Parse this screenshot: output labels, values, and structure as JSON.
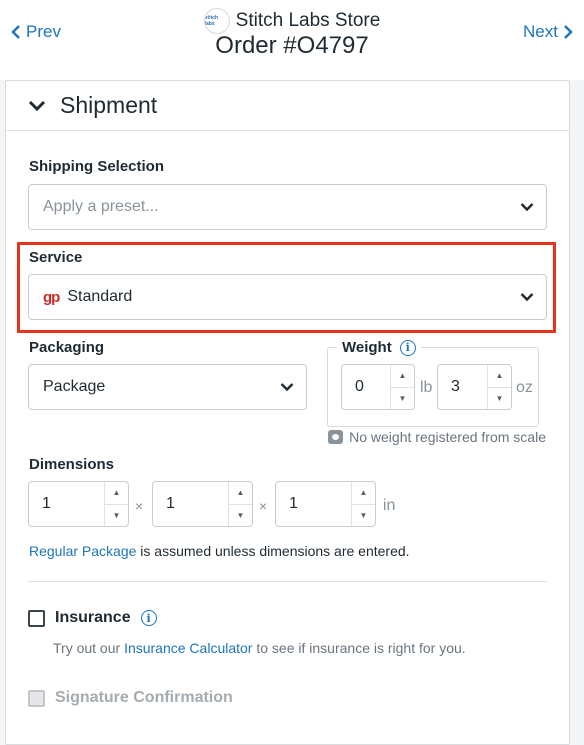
{
  "nav": {
    "prev_label": "Prev",
    "next_label": "Next"
  },
  "store": {
    "logo_text": "stitch labs",
    "name": "Stitch Labs Store"
  },
  "order": {
    "title": "Order #O4797"
  },
  "section": {
    "title": "Shipment"
  },
  "shipping_selection": {
    "label": "Shipping Selection",
    "placeholder": "Apply a preset..."
  },
  "service": {
    "label": "Service",
    "carrier_icon": "gp",
    "value": "Standard",
    "highlight_color": "#e8341c"
  },
  "packaging": {
    "label": "Packaging",
    "value": "Package"
  },
  "weight": {
    "label": "Weight",
    "lb_value": "0",
    "lb_unit": "lb",
    "oz_value": "3",
    "oz_unit": "oz",
    "scale_note": "No weight registered from scale"
  },
  "dimensions": {
    "label": "Dimensions",
    "length": "1",
    "width": "1",
    "height": "1",
    "separator": "×",
    "unit": "in",
    "hint_link": "Regular Package",
    "hint_text": " is assumed unless dimensions are entered."
  },
  "insurance": {
    "label": "Insurance",
    "note_prefix": "Try out our ",
    "note_link": "Insurance Calculator",
    "note_suffix": " to see if insurance is right for you."
  },
  "signature": {
    "label": "Signature Confirmation"
  },
  "colors": {
    "accent": "#1d75bc",
    "text": "#1f2a33",
    "muted": "#8a939b"
  }
}
